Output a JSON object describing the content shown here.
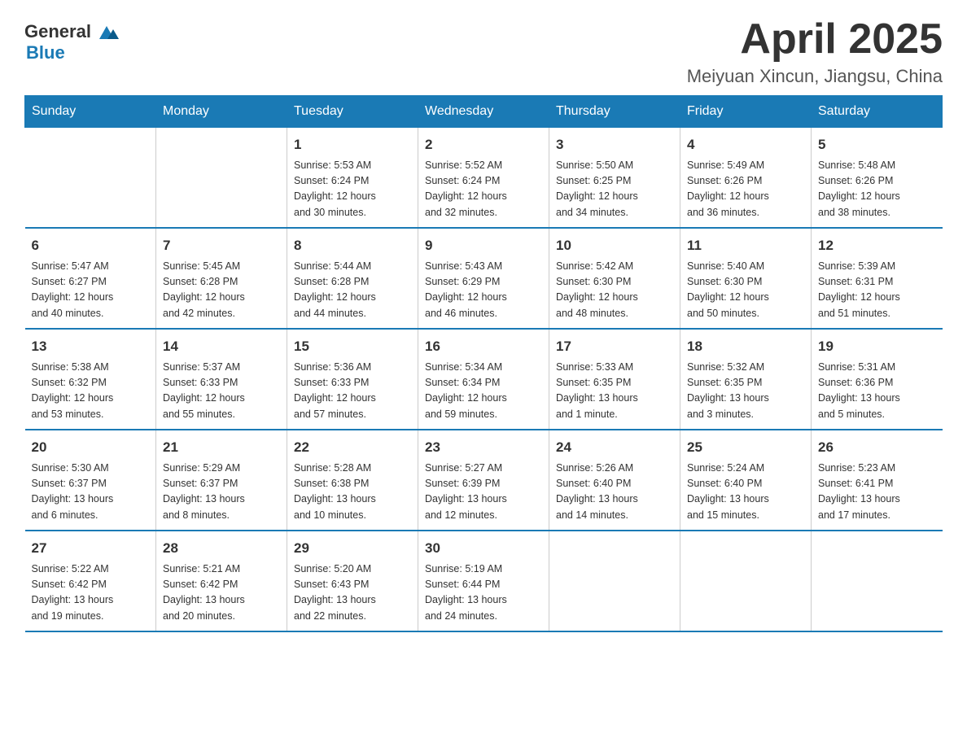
{
  "header": {
    "logo_text_general": "General",
    "logo_text_blue": "Blue",
    "title": "April 2025",
    "subtitle": "Meiyuan Xincun, Jiangsu, China"
  },
  "weekdays": [
    "Sunday",
    "Monday",
    "Tuesday",
    "Wednesday",
    "Thursday",
    "Friday",
    "Saturday"
  ],
  "weeks": [
    [
      {
        "day": "",
        "info": ""
      },
      {
        "day": "",
        "info": ""
      },
      {
        "day": "1",
        "info": "Sunrise: 5:53 AM\nSunset: 6:24 PM\nDaylight: 12 hours\nand 30 minutes."
      },
      {
        "day": "2",
        "info": "Sunrise: 5:52 AM\nSunset: 6:24 PM\nDaylight: 12 hours\nand 32 minutes."
      },
      {
        "day": "3",
        "info": "Sunrise: 5:50 AM\nSunset: 6:25 PM\nDaylight: 12 hours\nand 34 minutes."
      },
      {
        "day": "4",
        "info": "Sunrise: 5:49 AM\nSunset: 6:26 PM\nDaylight: 12 hours\nand 36 minutes."
      },
      {
        "day": "5",
        "info": "Sunrise: 5:48 AM\nSunset: 6:26 PM\nDaylight: 12 hours\nand 38 minutes."
      }
    ],
    [
      {
        "day": "6",
        "info": "Sunrise: 5:47 AM\nSunset: 6:27 PM\nDaylight: 12 hours\nand 40 minutes."
      },
      {
        "day": "7",
        "info": "Sunrise: 5:45 AM\nSunset: 6:28 PM\nDaylight: 12 hours\nand 42 minutes."
      },
      {
        "day": "8",
        "info": "Sunrise: 5:44 AM\nSunset: 6:28 PM\nDaylight: 12 hours\nand 44 minutes."
      },
      {
        "day": "9",
        "info": "Sunrise: 5:43 AM\nSunset: 6:29 PM\nDaylight: 12 hours\nand 46 minutes."
      },
      {
        "day": "10",
        "info": "Sunrise: 5:42 AM\nSunset: 6:30 PM\nDaylight: 12 hours\nand 48 minutes."
      },
      {
        "day": "11",
        "info": "Sunrise: 5:40 AM\nSunset: 6:30 PM\nDaylight: 12 hours\nand 50 minutes."
      },
      {
        "day": "12",
        "info": "Sunrise: 5:39 AM\nSunset: 6:31 PM\nDaylight: 12 hours\nand 51 minutes."
      }
    ],
    [
      {
        "day": "13",
        "info": "Sunrise: 5:38 AM\nSunset: 6:32 PM\nDaylight: 12 hours\nand 53 minutes."
      },
      {
        "day": "14",
        "info": "Sunrise: 5:37 AM\nSunset: 6:33 PM\nDaylight: 12 hours\nand 55 minutes."
      },
      {
        "day": "15",
        "info": "Sunrise: 5:36 AM\nSunset: 6:33 PM\nDaylight: 12 hours\nand 57 minutes."
      },
      {
        "day": "16",
        "info": "Sunrise: 5:34 AM\nSunset: 6:34 PM\nDaylight: 12 hours\nand 59 minutes."
      },
      {
        "day": "17",
        "info": "Sunrise: 5:33 AM\nSunset: 6:35 PM\nDaylight: 13 hours\nand 1 minute."
      },
      {
        "day": "18",
        "info": "Sunrise: 5:32 AM\nSunset: 6:35 PM\nDaylight: 13 hours\nand 3 minutes."
      },
      {
        "day": "19",
        "info": "Sunrise: 5:31 AM\nSunset: 6:36 PM\nDaylight: 13 hours\nand 5 minutes."
      }
    ],
    [
      {
        "day": "20",
        "info": "Sunrise: 5:30 AM\nSunset: 6:37 PM\nDaylight: 13 hours\nand 6 minutes."
      },
      {
        "day": "21",
        "info": "Sunrise: 5:29 AM\nSunset: 6:37 PM\nDaylight: 13 hours\nand 8 minutes."
      },
      {
        "day": "22",
        "info": "Sunrise: 5:28 AM\nSunset: 6:38 PM\nDaylight: 13 hours\nand 10 minutes."
      },
      {
        "day": "23",
        "info": "Sunrise: 5:27 AM\nSunset: 6:39 PM\nDaylight: 13 hours\nand 12 minutes."
      },
      {
        "day": "24",
        "info": "Sunrise: 5:26 AM\nSunset: 6:40 PM\nDaylight: 13 hours\nand 14 minutes."
      },
      {
        "day": "25",
        "info": "Sunrise: 5:24 AM\nSunset: 6:40 PM\nDaylight: 13 hours\nand 15 minutes."
      },
      {
        "day": "26",
        "info": "Sunrise: 5:23 AM\nSunset: 6:41 PM\nDaylight: 13 hours\nand 17 minutes."
      }
    ],
    [
      {
        "day": "27",
        "info": "Sunrise: 5:22 AM\nSunset: 6:42 PM\nDaylight: 13 hours\nand 19 minutes."
      },
      {
        "day": "28",
        "info": "Sunrise: 5:21 AM\nSunset: 6:42 PM\nDaylight: 13 hours\nand 20 minutes."
      },
      {
        "day": "29",
        "info": "Sunrise: 5:20 AM\nSunset: 6:43 PM\nDaylight: 13 hours\nand 22 minutes."
      },
      {
        "day": "30",
        "info": "Sunrise: 5:19 AM\nSunset: 6:44 PM\nDaylight: 13 hours\nand 24 minutes."
      },
      {
        "day": "",
        "info": ""
      },
      {
        "day": "",
        "info": ""
      },
      {
        "day": "",
        "info": ""
      }
    ]
  ]
}
